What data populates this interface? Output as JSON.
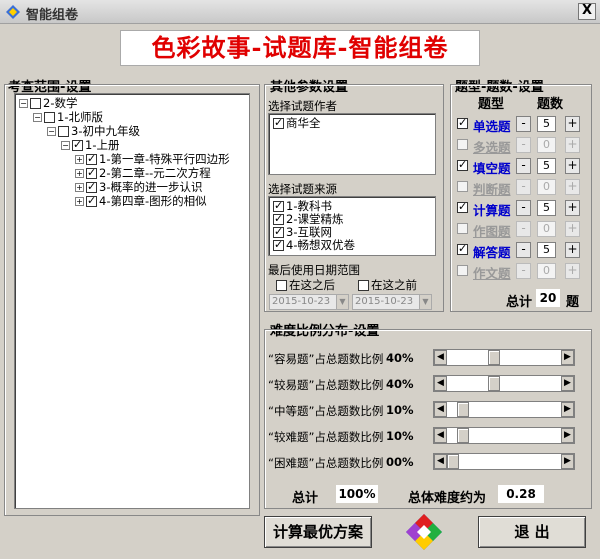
{
  "window": {
    "title": "智能组卷",
    "close_label": "X"
  },
  "main_title": "色彩故事-试题库-智能组卷",
  "scope": {
    "title": "考查范围-设置",
    "tree": [
      {
        "label": "2-数学"
      },
      {
        "label": "1-北师版"
      },
      {
        "label": "3-初中九年级"
      },
      {
        "label": "1-上册"
      },
      {
        "label": "1-第一章-特殊平行四边形"
      },
      {
        "label": "2-第二章--元二次方程"
      },
      {
        "label": "3-概率的进一步认识"
      },
      {
        "label": "4-第四章-图形的相似"
      }
    ]
  },
  "params": {
    "title": "其他参数设置",
    "author_label": "选择试题作者",
    "authors": [
      {
        "label": "商华全"
      }
    ],
    "source_label": "选择试题来源",
    "sources": [
      {
        "label": "1-教科书"
      },
      {
        "label": "2-课堂精炼"
      },
      {
        "label": "3-互联网"
      },
      {
        "label": "4-畅想双优卷"
      }
    ],
    "date_label": "最后使用日期范围",
    "after_label": "在这之后",
    "before_label": "在这之前",
    "after_date": "2015-10-23",
    "before_date": "2015-10-23"
  },
  "qtypes": {
    "title": "题型-题数-设置",
    "col_type": "题型",
    "col_count": "题数",
    "rows": [
      {
        "label": "单选题",
        "value": "5",
        "checked": true
      },
      {
        "label": "多选题",
        "value": "0",
        "checked": false
      },
      {
        "label": "填空题",
        "value": "5",
        "checked": true
      },
      {
        "label": "判断题",
        "value": "0",
        "checked": false
      },
      {
        "label": "计算题",
        "value": "5",
        "checked": true
      },
      {
        "label": "作图题",
        "value": "0",
        "checked": false
      },
      {
        "label": "解答题",
        "value": "5",
        "checked": true
      },
      {
        "label": "作文题",
        "value": "0",
        "checked": false
      }
    ],
    "minus": "-",
    "plus": "+",
    "total_label": "总计",
    "total_value": "20",
    "total_unit": "题"
  },
  "difficulty": {
    "title": "难度比例分布-设置",
    "rows": [
      {
        "label": "“容易题”占总题数比例",
        "pct": "40%",
        "level": 0.4
      },
      {
        "label": "“较易题”占总题数比例",
        "pct": "40%",
        "level": 0.4
      },
      {
        "label": "“中等题”占总题数比例",
        "pct": "10%",
        "level": 0.1
      },
      {
        "label": "“较难题”占总题数比例",
        "pct": "10%",
        "level": 0.1
      },
      {
        "label": "“困难题”占总题数比例",
        "pct": "00%",
        "level": 0.0
      }
    ],
    "total_label": "总计",
    "total_value": "100%",
    "overall_label": "总体难度约为",
    "overall_value": "0.28"
  },
  "buttons": {
    "compute": "计算最优方案",
    "exit": "退    出"
  },
  "colors": {
    "title_red": "#e00000",
    "label_blue": "#0000cc",
    "window_bg": "#d4d0c8"
  }
}
